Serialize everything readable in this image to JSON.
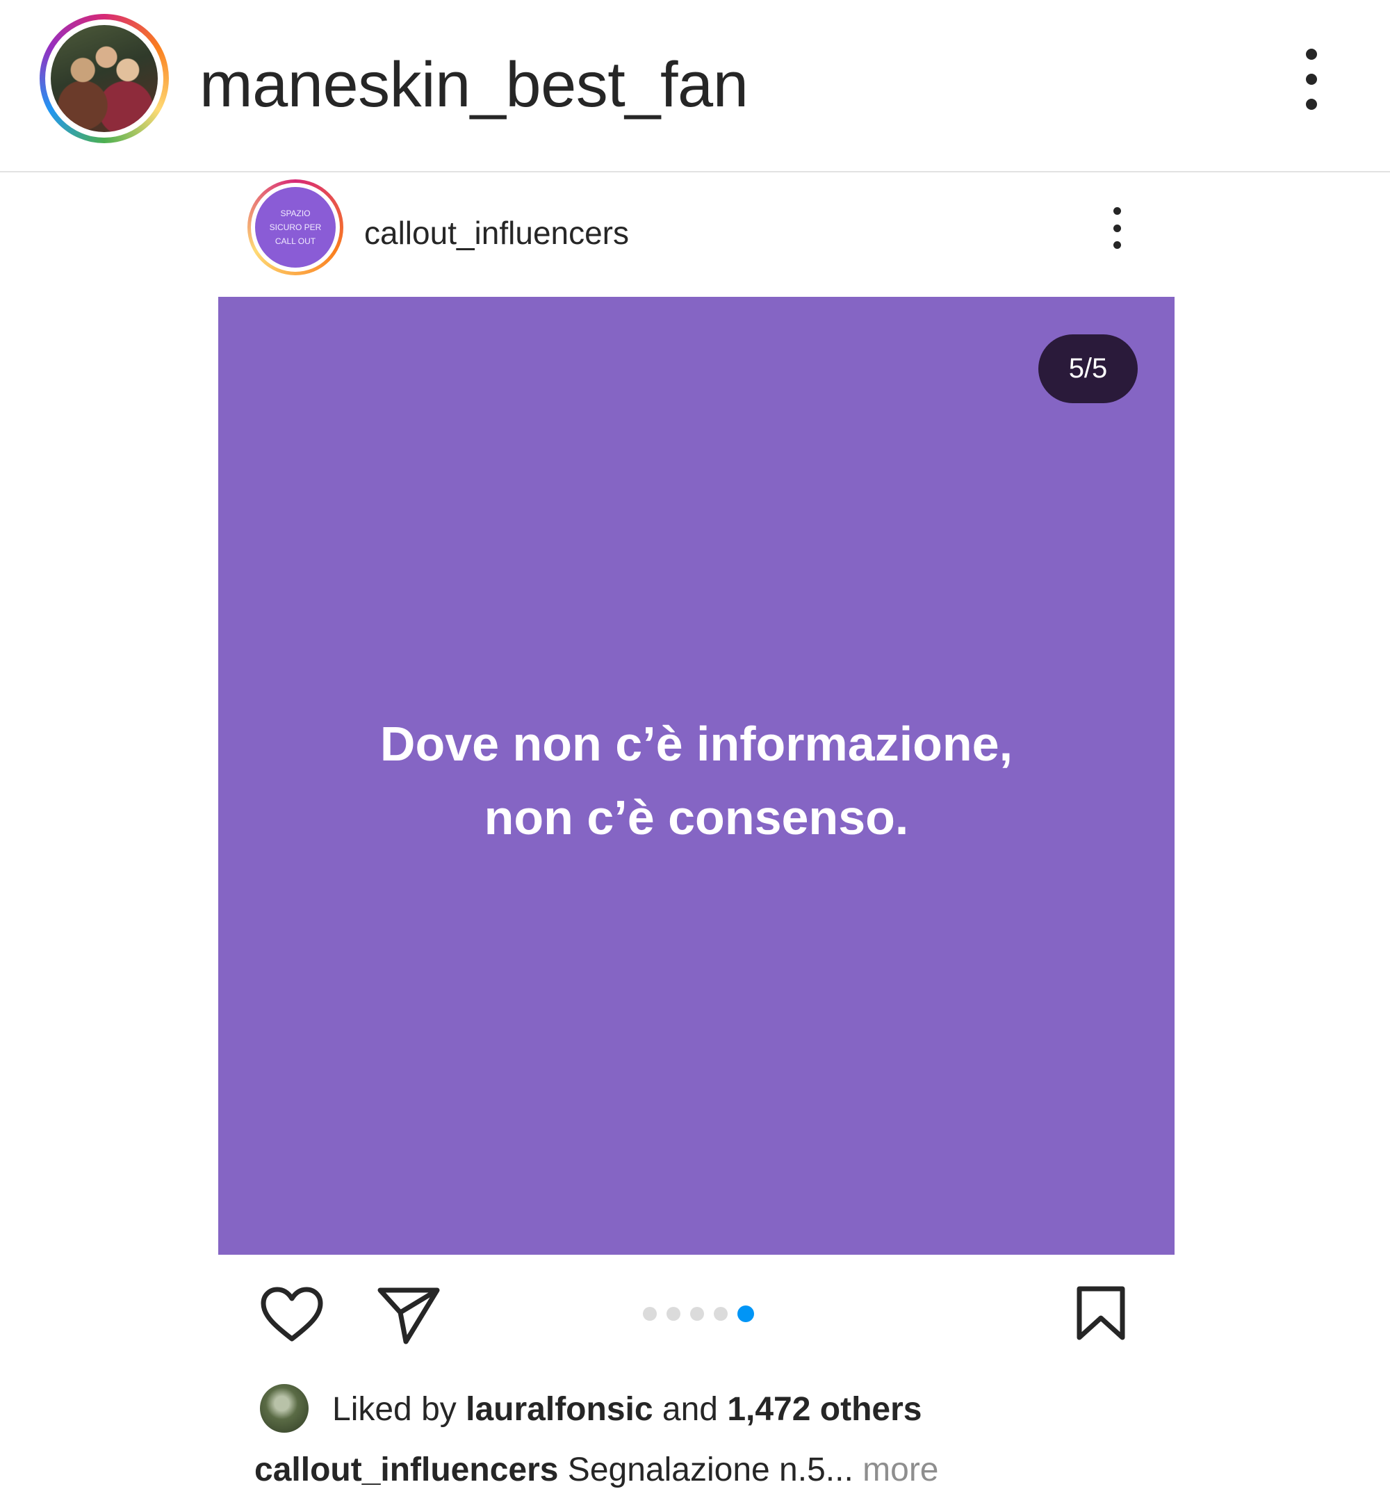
{
  "header": {
    "account_name": "maneskin_best_fan",
    "avatar_icon": "profile-photo-avatar"
  },
  "post": {
    "username": "callout_influencers",
    "avatar_text": [
      "SPAZIO",
      "SICURO PER",
      "CALL OUT"
    ],
    "page_counter": "5/5",
    "image": {
      "background_color": "#8565c4",
      "quote_lines": [
        "Dove non c’è informazione,",
        "non c’è consenso."
      ]
    },
    "carousel": {
      "total": 5,
      "active_index": 4
    },
    "actions": {
      "like_icon": "heart-icon",
      "share_icon": "paper-plane-icon",
      "save_icon": "bookmark-icon"
    },
    "likes": {
      "prefix": "Liked by ",
      "liker": "lauralfonsic",
      "middle": " and ",
      "others": "1,472 others"
    },
    "caption": {
      "user": "callout_influencers",
      "text": " Segnalazione n.5",
      "ellipsis": "...",
      "more": " more"
    }
  },
  "colors": {
    "accent_blue": "#0095f6",
    "text_primary": "#262626",
    "text_secondary": "#8e8e8e",
    "counter_bg": "#2a1a3a"
  }
}
